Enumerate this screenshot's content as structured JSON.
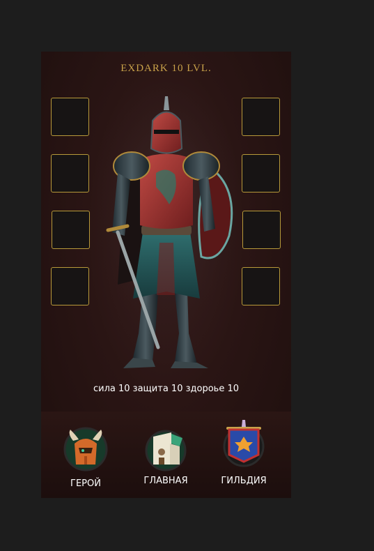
{
  "hero": {
    "title": "EXDARK 10 LVL.",
    "stats_text": "сила 10  защита 10 здороье 10"
  },
  "equipment": {
    "left_slots": [
      "",
      "",
      "",
      ""
    ],
    "right_slots": [
      "",
      "",
      "",
      ""
    ]
  },
  "nav": {
    "items": [
      {
        "label": "ГЕРОЙ",
        "icon": "helmet-icon"
      },
      {
        "label": "ГЛАВНАЯ",
        "icon": "castle-icon"
      },
      {
        "label": "ГИЛЬДИЯ",
        "icon": "guild-banner-icon"
      }
    ]
  },
  "colors": {
    "background": "#1d1d1d",
    "panel": "#2a1514",
    "accent_gold": "#c9a24a",
    "slot_border": "#b89a3a"
  }
}
